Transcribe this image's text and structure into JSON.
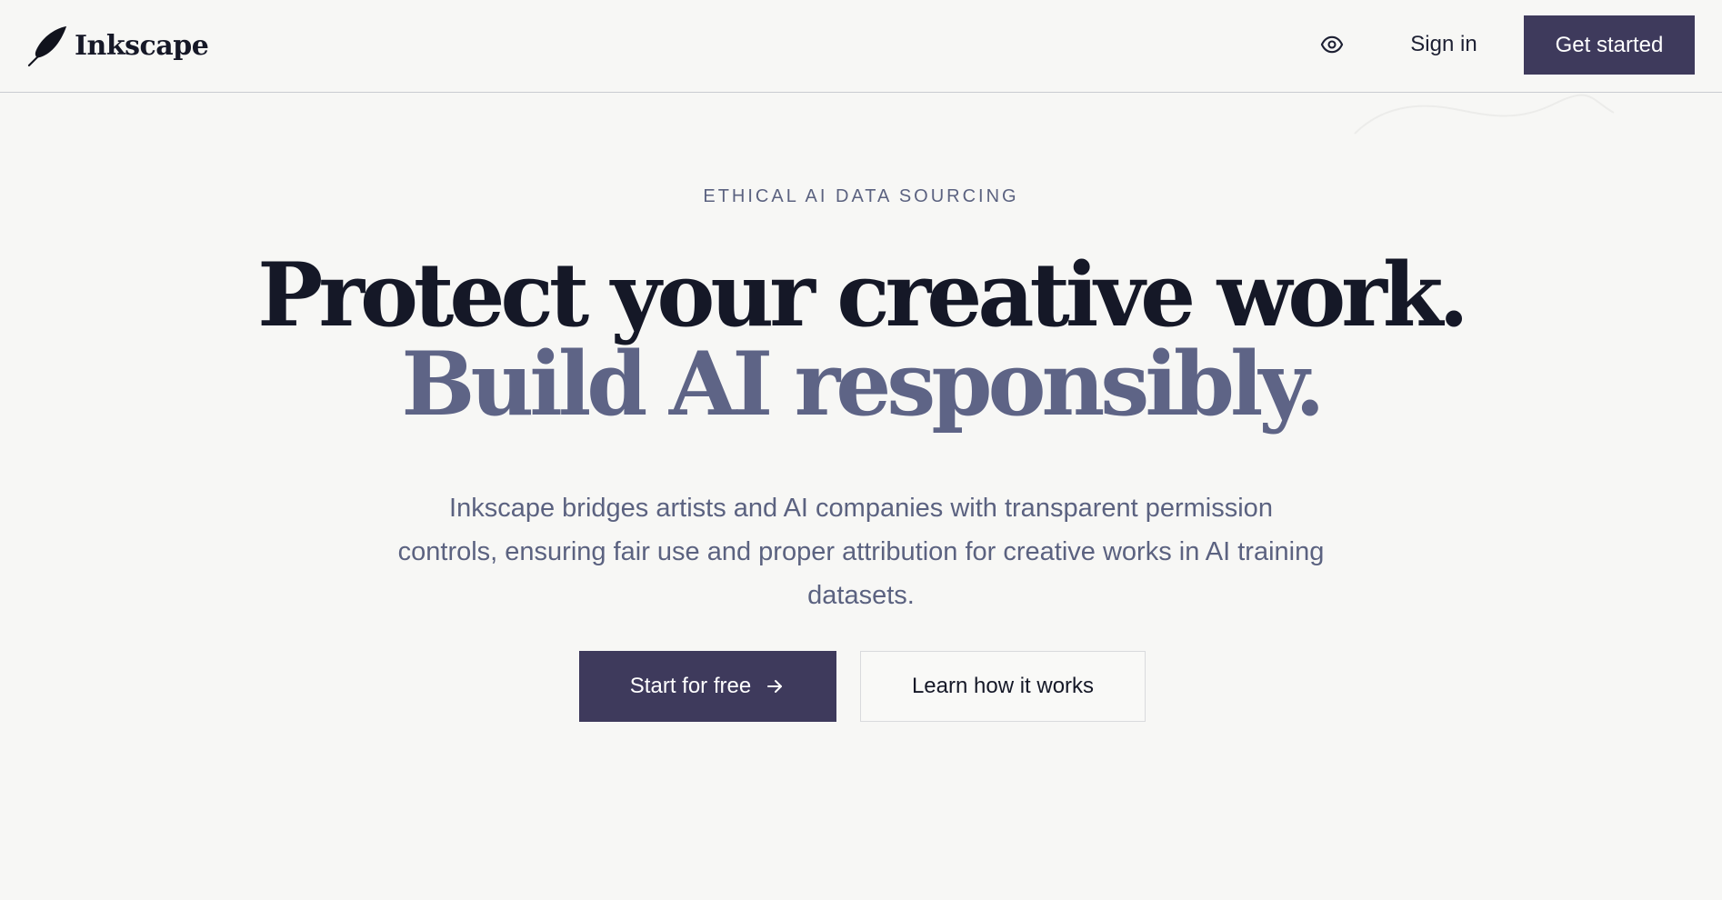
{
  "header": {
    "logo_text": "Inkscape",
    "logo_icon": "feather-icon",
    "visibility_icon": "eye-icon",
    "signin_label": "Sign in",
    "get_started_label": "Get started"
  },
  "hero": {
    "eyebrow": "ETHICAL AI DATA SOURCING",
    "headline_line1": "Protect your creative work.",
    "headline_line2": "Build AI responsibly.",
    "description": "Inkscape bridges artists and AI companies with transparent permission controls, ensuring fair use and proper attribution for creative works in AI training datasets.",
    "primary_cta": "Start for free",
    "primary_cta_icon": "arrow-right-icon",
    "secondary_cta": "Learn how it works"
  },
  "colors": {
    "background": "#f7f7f5",
    "primary": "#3e3a5c",
    "heading_dark": "#151827",
    "heading_muted": "#5e6486",
    "body_text": "#5b6280"
  }
}
